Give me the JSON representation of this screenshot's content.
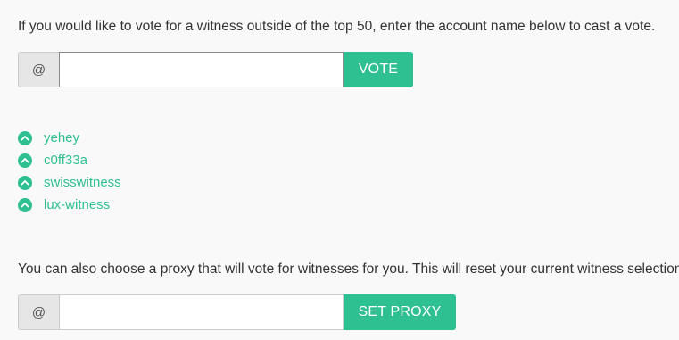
{
  "vote_section": {
    "intro_text": "If you would like to vote for a witness outside of the top 50, enter the account name below to cast a vote.",
    "at_symbol": "@",
    "input_value": "",
    "button_label": "VOTE"
  },
  "witnesses": [
    {
      "name": "yehey",
      "icon": "upvote-chevron-icon"
    },
    {
      "name": "c0ff33a",
      "icon": "upvote-chevron-icon"
    },
    {
      "name": "swisswitness",
      "icon": "upvote-chevron-icon"
    },
    {
      "name": "lux-witness",
      "icon": "upvote-chevron-icon"
    }
  ],
  "proxy_section": {
    "intro_text": "You can also choose a proxy that will vote for witnesses for you. This will reset your current witness selection.",
    "at_symbol": "@",
    "input_value": "",
    "button_label": "SET PROXY"
  },
  "colors": {
    "accent": "#2fc091",
    "background": "#f9f9f9",
    "addon_bg": "#e6e6e6",
    "text": "#333333"
  }
}
